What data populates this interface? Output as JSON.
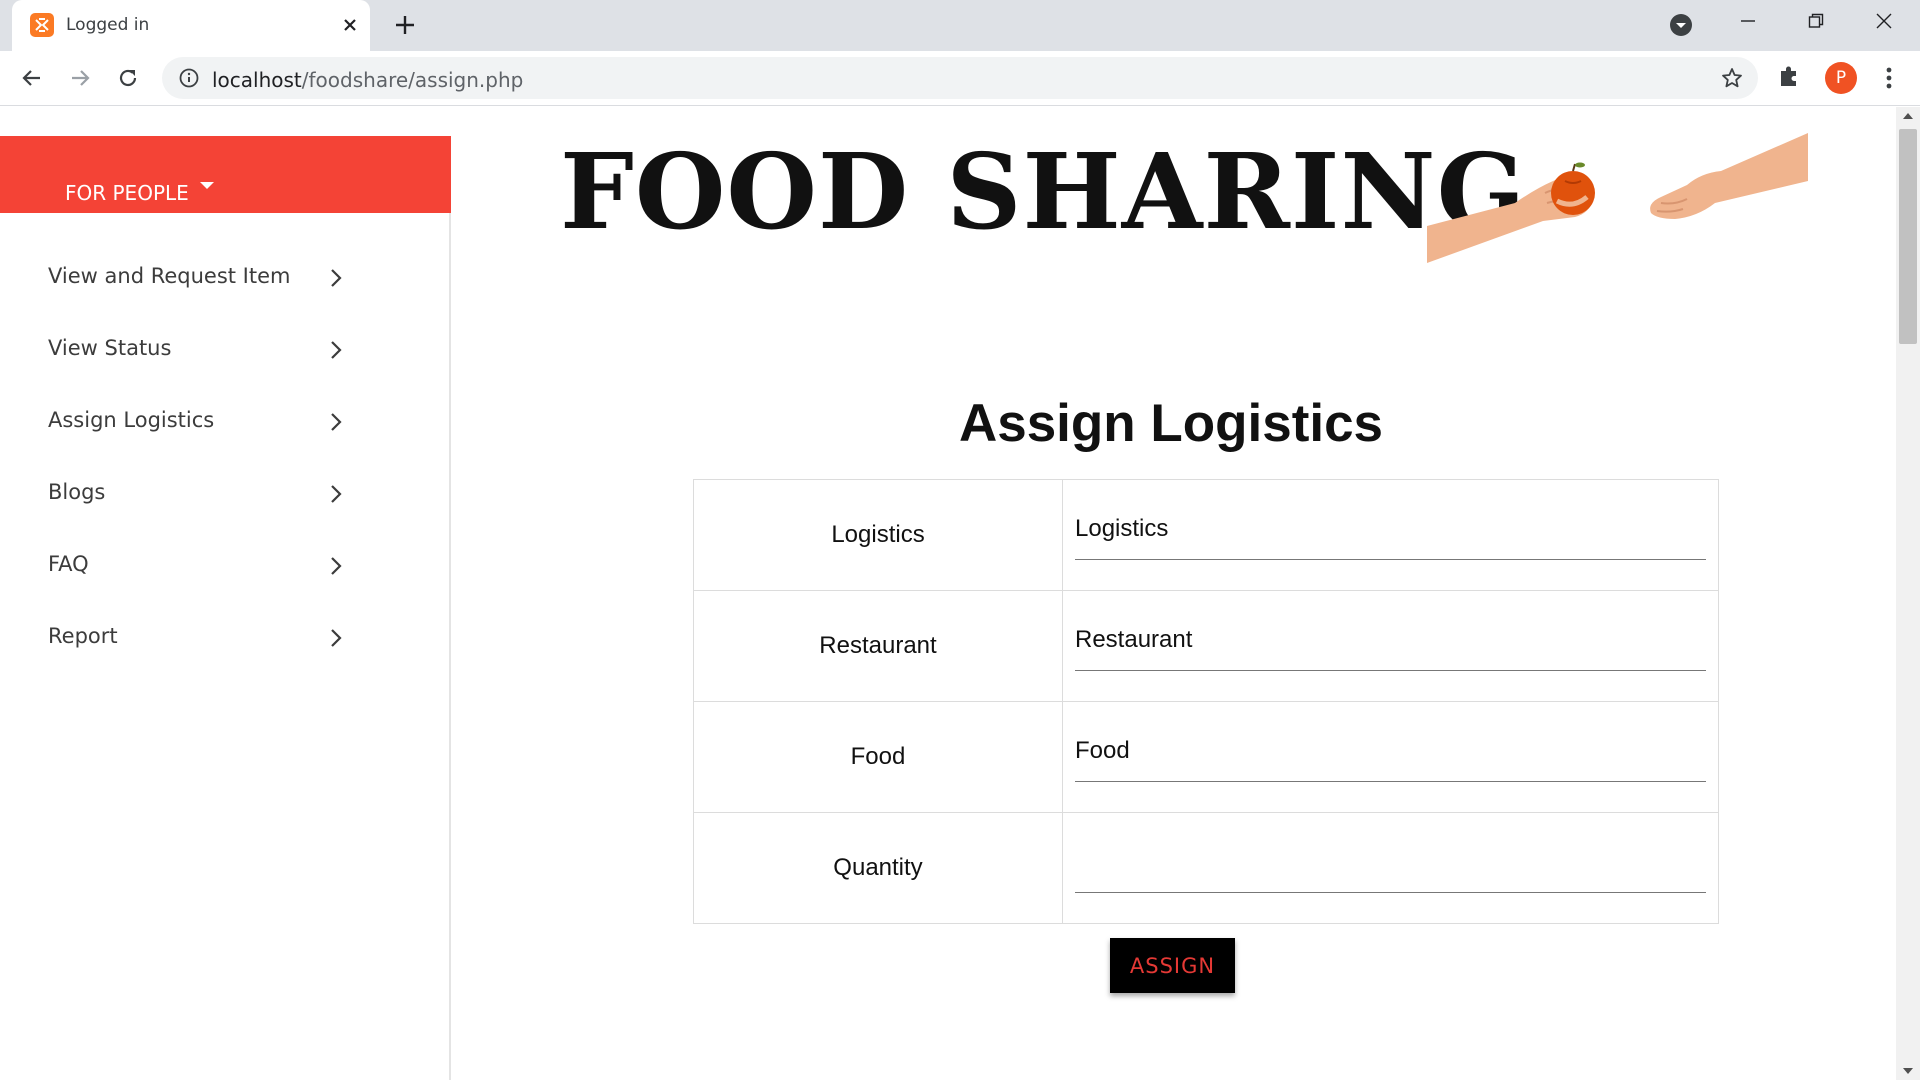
{
  "browser": {
    "tab_title": "Logged in",
    "url_host": "localhost",
    "url_path": "/foodshare/assign.php",
    "profile_initial": "P"
  },
  "colors": {
    "accent": "#f44336",
    "button_bg": "#000000",
    "button_text": "#e53935",
    "profile": "#f05223"
  },
  "sidebar": {
    "header_label": "FOR PEOPLE",
    "items": [
      {
        "label": "View and Request Item"
      },
      {
        "label": "View Status"
      },
      {
        "label": "Assign Logistics"
      },
      {
        "label": "Blogs"
      },
      {
        "label": "FAQ"
      },
      {
        "label": "Report"
      }
    ]
  },
  "banner": {
    "title": "FOOD SHARING",
    "image": "hands-sharing-apple-illustration"
  },
  "form": {
    "heading": "Assign Logistics",
    "rows": [
      {
        "label": "Logistics",
        "placeholder": "Logistics",
        "value": ""
      },
      {
        "label": "Restaurant",
        "placeholder": "Restaurant",
        "value": ""
      },
      {
        "label": "Food",
        "placeholder": "Food",
        "value": ""
      },
      {
        "label": "Quantity",
        "placeholder": "",
        "value": ""
      }
    ],
    "submit_label": "ASSIGN"
  }
}
